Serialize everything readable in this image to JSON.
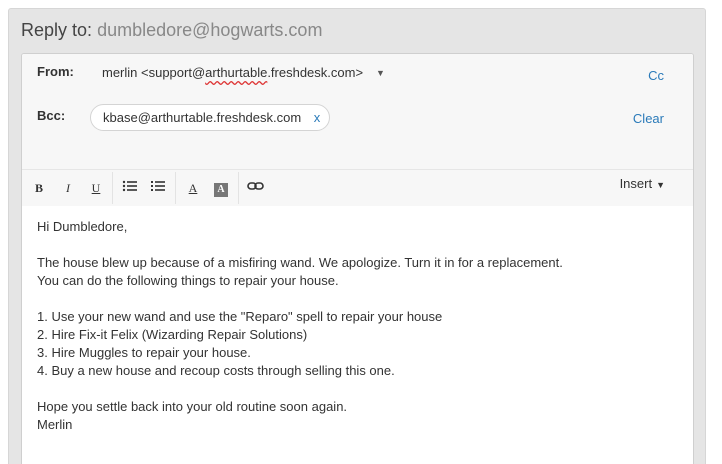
{
  "reply_to": {
    "label": "Reply to:",
    "address": "dumbledore@hogwarts.com"
  },
  "from": {
    "label": "From:",
    "name": "merlin <support@",
    "domain_underlined": "arthurtable",
    "domain_rest": ".freshdesk.com>",
    "cc_label": "Cc"
  },
  "bcc": {
    "label": "Bcc:",
    "chip": "kbase@arthurtable.freshdesk.com",
    "chip_remove": "x",
    "clear_label": "Clear"
  },
  "toolbar": {
    "bold": "B",
    "italic": "I",
    "underline": "U",
    "font_color": "A",
    "bg_color": "A",
    "insert_label": "Insert"
  },
  "icons": {
    "bold": "bold-icon",
    "italic": "italic-icon",
    "underline": "underline-icon",
    "bullet_list": "bullet-list-icon",
    "numbered_list": "numbered-list-icon",
    "font_color": "font-color-icon",
    "background_color": "background-color-icon",
    "link": "link-icon",
    "dropdown": "chevron-down-icon"
  },
  "colors": {
    "accent": "#2a7ab9",
    "header_bg": "#f7f7f7",
    "outer_bg": "#e5e5e5"
  },
  "body": {
    "lines": [
      "Hi Dumbledore,",
      "",
      "The house blew up because of a misfiring wand. We apologize. Turn it in for a replacement.",
      "You can do the following things to repair your house.",
      "",
      "1. Use your new wand and use the \"Reparo\" spell to repair your house",
      "2. Hire Fix-it Felix (Wizarding Repair Solutions)",
      "3. Hire Muggles to repair your house.",
      "4. Buy a new house and recoup costs through selling this one.",
      "",
      "Hope you settle back into your old routine soon again.",
      "Merlin"
    ]
  }
}
